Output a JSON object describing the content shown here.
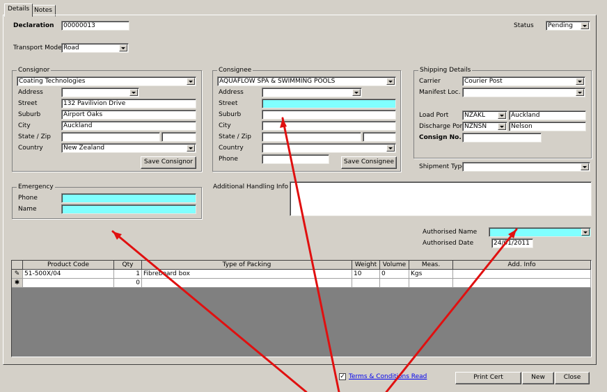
{
  "tabs": [
    {
      "label": "Details"
    },
    {
      "label": "Notes"
    }
  ],
  "header": {
    "declaration_label": "Declaration",
    "declaration_value": "00000013",
    "status_label": "Status",
    "status_value": "Pending",
    "transport_label": "Transport Mode",
    "transport_value": "Road"
  },
  "consignor": {
    "title": "Consignor",
    "name": "Coating Technologies",
    "address_label": "Address",
    "address": "",
    "street_label": "Street",
    "street": "132 Pavilivion Drive",
    "suburb_label": "Suburb",
    "suburb": "Airport Oaks",
    "city_label": "City",
    "city": "Auckland",
    "state_label": "State / Zip",
    "state": "",
    "zip": "",
    "country_label": "Country",
    "country": "New Zealand",
    "save_label": "Save Consignor"
  },
  "consignee": {
    "title": "Consignee",
    "name": "AQUAFLOW SPA & SWIMMING POOLS",
    "address_label": "Address",
    "address": "",
    "street_label": "Street",
    "street": "",
    "suburb_label": "Suburb",
    "suburb": "",
    "city_label": "City",
    "city": "",
    "state_label": "State / Zip",
    "state": "",
    "zip": "",
    "country_label": "Country",
    "country": "",
    "phone_label": "Phone",
    "phone": "",
    "save_label": "Save Consignee"
  },
  "shipping": {
    "title": "Shipping Details",
    "carrier_label": "Carrier",
    "carrier": "Courier Post",
    "manifest_label": "Manifest Loc.",
    "manifest": "",
    "load_port_label": "Load Port",
    "load_port_code": "NZAKL",
    "load_port_name": "Auckland",
    "discharge_port_label": "Discharge Port",
    "discharge_port_code": "NZNSN",
    "discharge_port_name": "Nelson",
    "consign_no_label": "Consign No.",
    "consign_no": "",
    "shipment_type_label": "Shipment Type",
    "shipment_type": ""
  },
  "emergency": {
    "title": "Emergency",
    "phone_label": "Phone",
    "phone": "",
    "name_label": "Name",
    "name": ""
  },
  "handling": {
    "label": "Additional Handling Info",
    "value": ""
  },
  "authorised": {
    "name_label": "Authorised Name",
    "name": "",
    "date_label": "Authorised Date",
    "date": "24/01/2011"
  },
  "grid": {
    "columns": [
      "Product Code",
      "Qty",
      "Type of Packing",
      "Weight",
      "Volume",
      "Meas.",
      "Add. Info"
    ],
    "rows": [
      {
        "indicator": "✎",
        "product_code": "51-500X/04",
        "qty": "1",
        "packing": "Fibreboard box",
        "weight": "10",
        "volume": "0",
        "meas": "Kgs",
        "info": ""
      },
      {
        "indicator": "✱",
        "product_code": "",
        "qty": "0",
        "packing": "",
        "weight": "",
        "volume": "",
        "meas": "",
        "info": ""
      }
    ]
  },
  "footer": {
    "terms_checked": "✓",
    "terms_label": "Terms & Conditions Read",
    "print_label": "Print Cert",
    "new_label": "New",
    "close_label": "Close"
  },
  "colors": {
    "required_field": "#80ffff",
    "annotation_arrow": "#e01010"
  }
}
